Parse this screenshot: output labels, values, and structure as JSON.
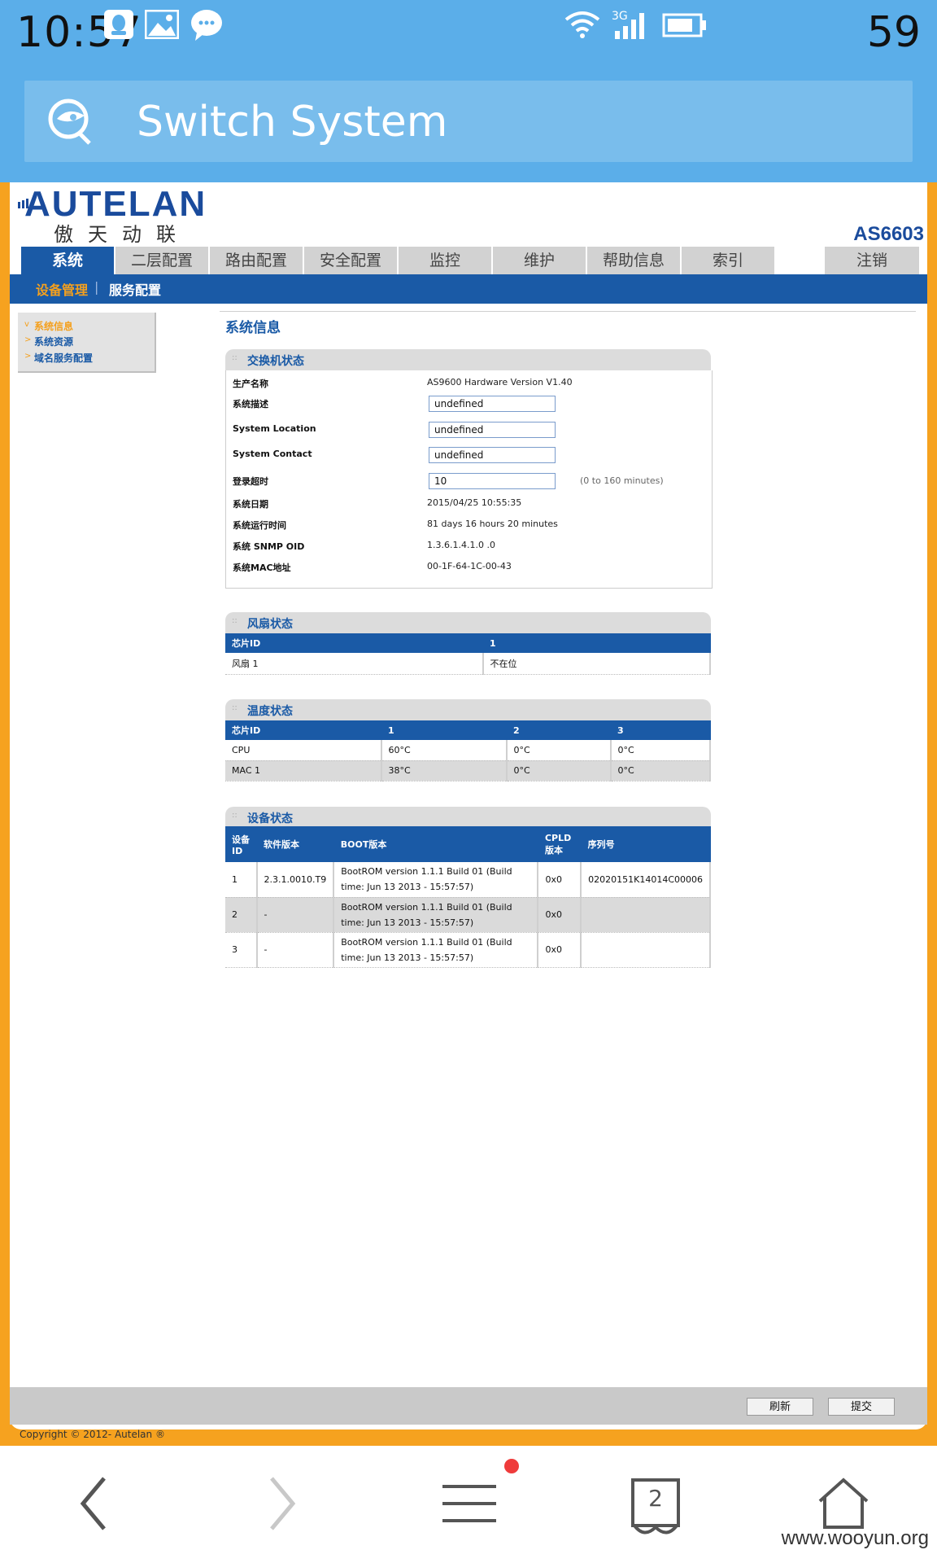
{
  "status_bar": {
    "time": "10:57",
    "battery": "59"
  },
  "app": {
    "title": "Switch System"
  },
  "brand": {
    "logo": "AUTELAN",
    "logo_sub": "傲天动联",
    "model": "AS6603"
  },
  "nav": {
    "tabs": [
      "系统",
      "二层配置",
      "路由配置",
      "安全配置",
      "监控",
      "维护",
      "帮助信息",
      "索引"
    ],
    "logout": "注销",
    "sub": [
      "设备管理",
      "服务配置"
    ]
  },
  "side_menu": [
    "系统信息",
    "系统资源",
    "域名服务配置"
  ],
  "page_title": "系统信息",
  "switch_status": {
    "title": "交换机状态",
    "rows": [
      {
        "label": "生产名称",
        "value": "AS9600 Hardware Version V1.40"
      },
      {
        "label": "系统描述",
        "input": "undefined"
      },
      {
        "label": "System Location",
        "input": "undefined"
      },
      {
        "label": "System Contact",
        "input": "undefined"
      },
      {
        "label": "登录超时",
        "input": "10",
        "hint": "(0 to 160 minutes)"
      },
      {
        "label": "系统日期",
        "value": "2015/04/25 10:55:35"
      },
      {
        "label": "系统运行时间",
        "value": "81 days 16 hours 20 minutes"
      },
      {
        "label": "系统 SNMP OID",
        "value": "1.3.6.1.4.1.0 .0"
      },
      {
        "label": "系统MAC地址",
        "value": "00-1F-64-1C-00-43"
      }
    ]
  },
  "fan_status": {
    "title": "风扇状态",
    "headers": [
      "芯片ID",
      "1"
    ],
    "rows": [
      [
        "风扇 1",
        "不在位"
      ]
    ]
  },
  "temp_status": {
    "title": "温度状态",
    "headers": [
      "芯片ID",
      "1",
      "2",
      "3"
    ],
    "rows": [
      [
        "CPU",
        "60°C",
        "0°C",
        "0°C"
      ],
      [
        "MAC 1",
        "38°C",
        "0°C",
        "0°C"
      ]
    ]
  },
  "device_status": {
    "title": "设备状态",
    "headers": [
      "设备ID",
      "软件版本",
      "BOOT版本",
      "CPLD版本",
      "序列号"
    ],
    "rows": [
      [
        "1",
        "2.3.1.0010.T9",
        "BootROM version 1.1.1 Build 01 (Build time: Jun 13 2013 - 15:57:57)",
        "0x0",
        "02020151K14014C00006"
      ],
      [
        "2",
        "-",
        "BootROM version 1.1.1 Build 01 (Build time: Jun 13 2013 - 15:57:57)",
        "0x0",
        ""
      ],
      [
        "3",
        "-",
        "BootROM version 1.1.1 Build 01 (Build time: Jun 13 2013 - 15:57:57)",
        "0x0",
        ""
      ]
    ]
  },
  "footer": {
    "refresh": "刷新",
    "submit": "提交",
    "copyright": "Copyright © 2012- Autelan ®"
  },
  "bottom_nav": {
    "tab_count": "2"
  },
  "watermark": "www.wooyun.org",
  "colors": {
    "header": "#5baee9",
    "nav_blue": "#1a5aa6",
    "frame": "#f6a21f"
  }
}
